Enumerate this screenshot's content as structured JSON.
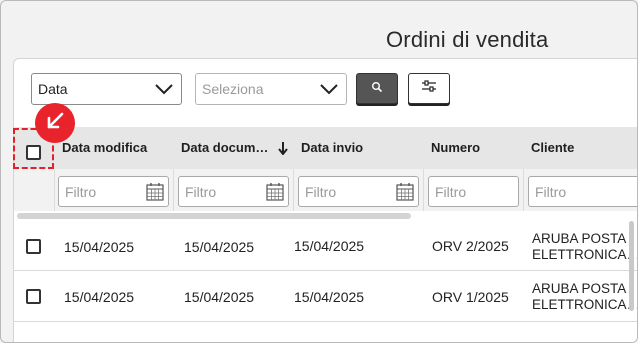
{
  "page": {
    "title": "Ordini di vendita"
  },
  "toolbar": {
    "date_select_value": "Data",
    "filter_select_placeholder": "Seleziona",
    "search_icon": "search-icon",
    "settings_icon": "sliders-icon"
  },
  "table": {
    "columns": [
      {
        "label": "Data modifica"
      },
      {
        "label": "Data docum…"
      },
      {
        "label": "Data invio"
      },
      {
        "label": "Numero"
      },
      {
        "label": "Cliente"
      }
    ],
    "sort": {
      "column": "Data docum…",
      "direction": "descending"
    },
    "filter_placeholder": "Filtro",
    "rows": [
      {
        "data_modifica": "15/04/2025",
        "data_documento": "15/04/2025",
        "data_invio": "15/04/2025",
        "numero": "ORV 2/2025",
        "cliente_line1": "ARUBA POSTA",
        "cliente_line2": "ELETTRONICA…"
      },
      {
        "data_modifica": "15/04/2025",
        "data_documento": "15/04/2025",
        "data_invio": "15/04/2025",
        "numero": "ORV 1/2025",
        "cliente_line1": "ARUBA POSTA",
        "cliente_line2": "ELETTRONICA…"
      }
    ]
  },
  "colors": {
    "accent_red": "#e8232b",
    "header_bg": "#e6e6e6",
    "search_button_bg": "#555555"
  }
}
